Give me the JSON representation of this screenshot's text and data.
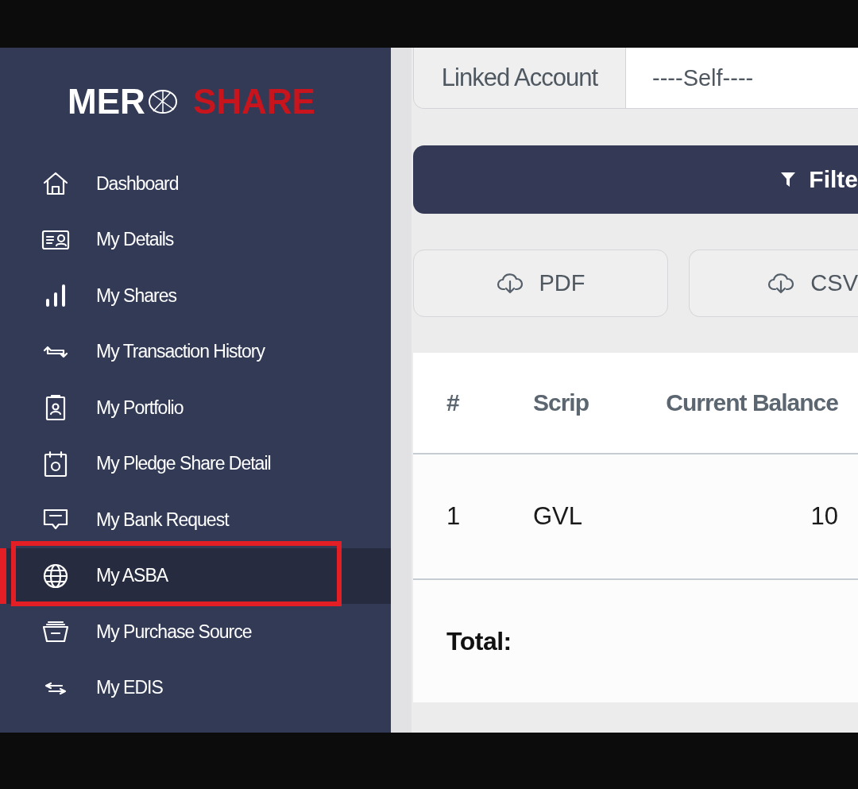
{
  "logo": {
    "left": "MER",
    "right": "SHARE"
  },
  "sidebar": {
    "items": [
      {
        "label": "Dashboard",
        "selected": false,
        "highlighted": false
      },
      {
        "label": "My Details",
        "selected": false,
        "highlighted": false
      },
      {
        "label": "My Shares",
        "selected": false,
        "highlighted": false
      },
      {
        "label": "My Transaction History",
        "selected": false,
        "highlighted": false
      },
      {
        "label": "My Portfolio",
        "selected": false,
        "highlighted": false
      },
      {
        "label": "My Pledge Share Detail",
        "selected": false,
        "highlighted": false
      },
      {
        "label": "My Bank Request",
        "selected": false,
        "highlighted": false
      },
      {
        "label": "My ASBA",
        "selected": true,
        "highlighted": true
      },
      {
        "label": "My Purchase Source",
        "selected": false,
        "highlighted": false
      },
      {
        "label": "My EDIS",
        "selected": false,
        "highlighted": false
      }
    ]
  },
  "linked_account": {
    "label": "Linked Account",
    "value": "----Self----"
  },
  "filter_button": {
    "label": "Filte"
  },
  "export_buttons": [
    "PDF",
    "CSV"
  ],
  "table": {
    "columns": [
      "#",
      "Scrip",
      "Current Balance"
    ],
    "rows": [
      [
        "1",
        "GVL",
        "10"
      ]
    ],
    "footer": "Total:"
  }
}
